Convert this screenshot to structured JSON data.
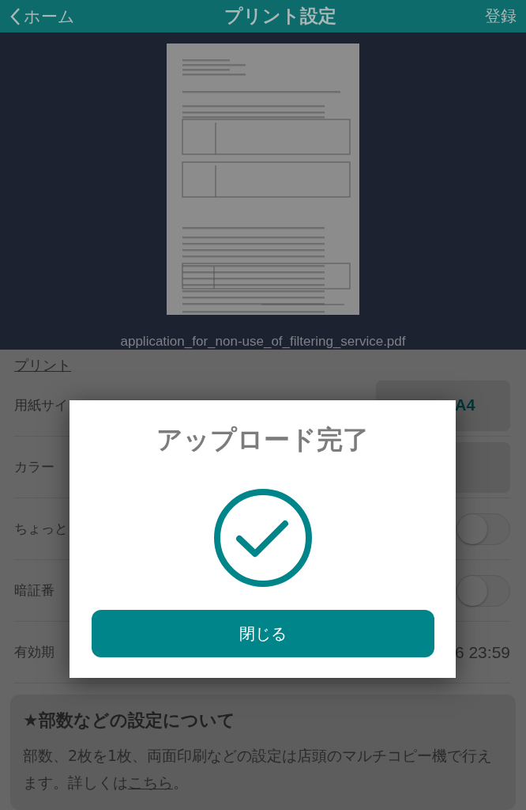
{
  "header": {
    "back_label": "ホーム",
    "title": "プリント設定",
    "action": "登録"
  },
  "preview": {
    "file_name": "application_for_non-use_of_filtering_service.pdf"
  },
  "price_link": "プリント",
  "settings": [
    {
      "kind": "select",
      "label": "用紙サイ",
      "value": "A4"
    },
    {
      "kind": "select",
      "label": "カラー"
    },
    {
      "kind": "toggle",
      "label": "ちょっと",
      "on": false
    },
    {
      "kind": "toggle",
      "label": "暗証番",
      "on": false
    },
    {
      "kind": "text",
      "label": "有効期",
      "value": "6 23:59"
    }
  ],
  "info": {
    "title": "★部数などの設定について",
    "body": "部数、2枚を1枚、両面印刷などの設定は店頭のマルチコピー機で行えます。詳しくは",
    "link": "こちら",
    "tail": "。"
  },
  "dialog": {
    "title": "アップロード完了",
    "button": "閉じる"
  }
}
